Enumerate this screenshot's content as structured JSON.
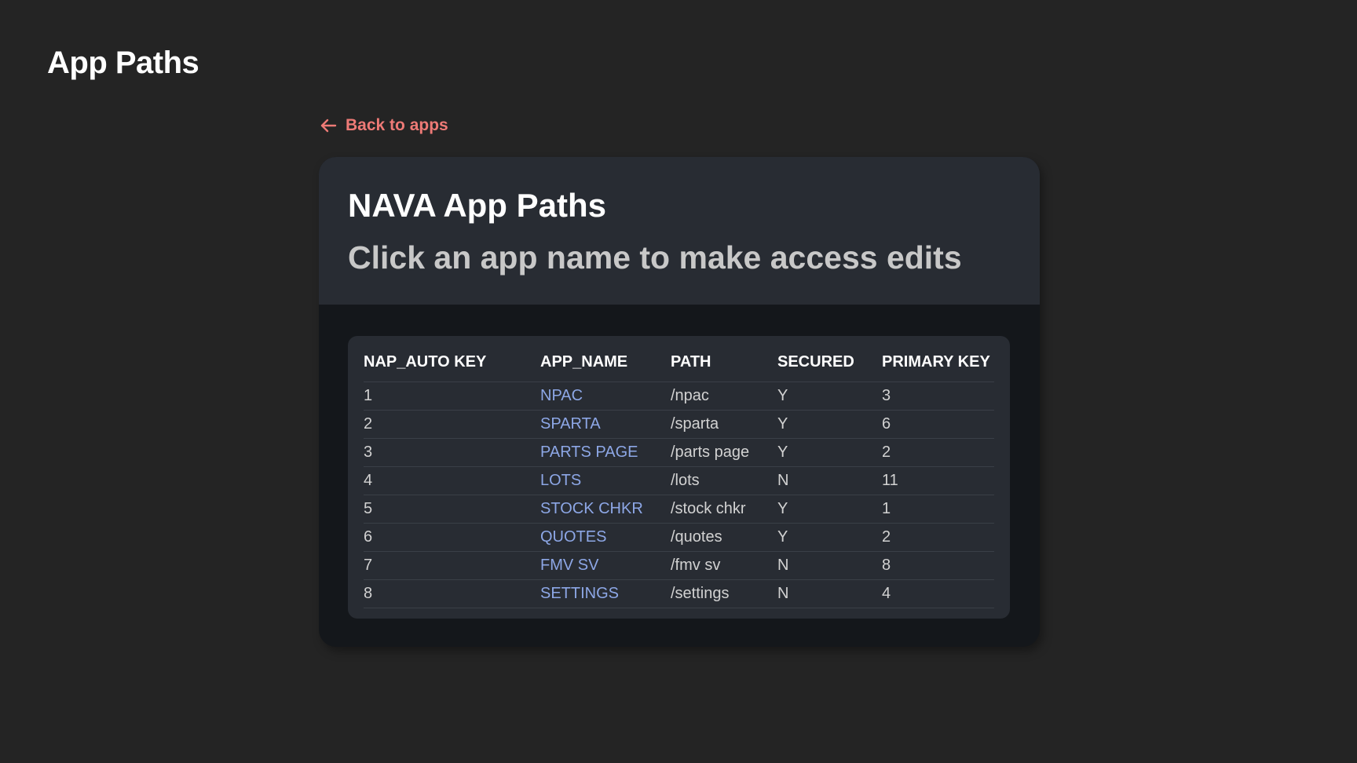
{
  "header": {
    "title": "App Paths"
  },
  "nav": {
    "back_label": "Back to apps",
    "back_icon": "arrow-left-icon",
    "accent_color": "#ee7a76"
  },
  "card": {
    "title": "NAVA App Paths",
    "subtitle": "Click an app name to make access edits"
  },
  "table": {
    "columns": [
      "NAP_AUTO KEY",
      "APP_NAME",
      "PATH",
      "SECURED",
      "PRIMARY KEY"
    ],
    "rows": [
      {
        "key": "1",
        "app_name": "NPAC",
        "path": "/npac",
        "secured": "Y",
        "primary_key": "3"
      },
      {
        "key": "2",
        "app_name": "SPARTA",
        "path": "/sparta",
        "secured": "Y",
        "primary_key": "6"
      },
      {
        "key": "3",
        "app_name": "PARTS PAGE",
        "path": "/parts page",
        "secured": "Y",
        "primary_key": "2"
      },
      {
        "key": "4",
        "app_name": "LOTS",
        "path": "/lots",
        "secured": "N",
        "primary_key": "11"
      },
      {
        "key": "5",
        "app_name": "STOCK CHKR",
        "path": "/stock chkr",
        "secured": "Y",
        "primary_key": "1"
      },
      {
        "key": "6",
        "app_name": "QUOTES",
        "path": "/quotes",
        "secured": "Y",
        "primary_key": "2"
      },
      {
        "key": "7",
        "app_name": "FMV SV",
        "path": "/fmv sv",
        "secured": "N",
        "primary_key": "8"
      },
      {
        "key": "8",
        "app_name": "SETTINGS",
        "path": "/settings",
        "secured": "N",
        "primary_key": "4"
      }
    ],
    "link_color": "#8da7e6"
  }
}
